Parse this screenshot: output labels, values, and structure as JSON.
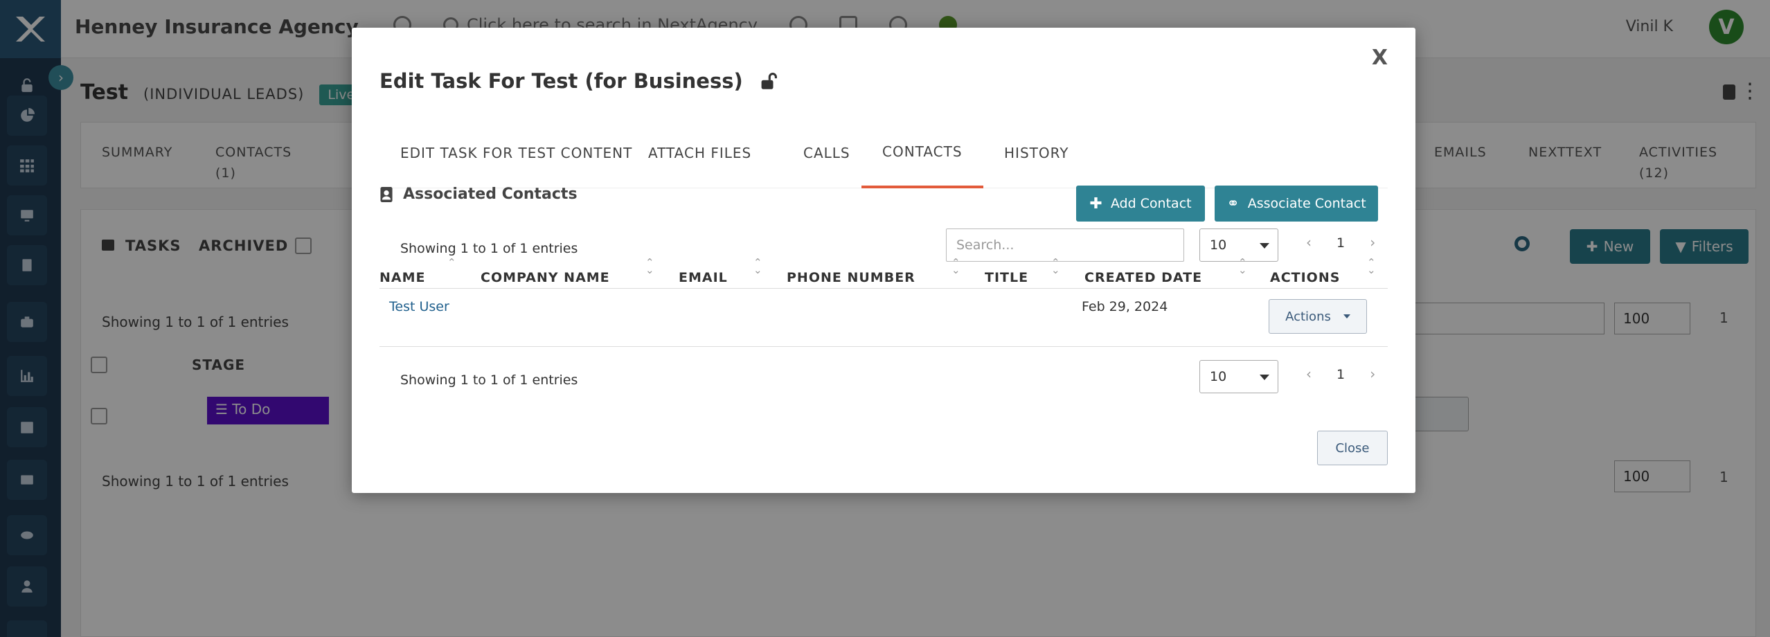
{
  "header": {
    "agency_name": "Henney Insurance Agency",
    "search_hint": "Click here to search in NextAgency",
    "user_name": "Vinil K",
    "avatar_initial": "V"
  },
  "record": {
    "title": "Test",
    "subtitle": "(INDIVIDUAL LEADS)",
    "status": "Live",
    "tabs": [
      {
        "label": "SUMMARY",
        "count": ""
      },
      {
        "label": "CONTACTS",
        "count": "(1)"
      },
      {
        "label": "EMAILS",
        "count": ""
      },
      {
        "label": "NEXTTEXT",
        "count": ""
      },
      {
        "label": "ACTIVITIES",
        "count": "(12)"
      }
    ]
  },
  "tasks_panel": {
    "title": "TASKS",
    "archived_label": "ARCHIVED",
    "showing_text": "Showing 1 to 1 of 1 entries",
    "stage_header": "STAGE",
    "stage_value": "To Do",
    "new_label": "New",
    "filters_label": "Filters",
    "page_size": "100",
    "page": "1"
  },
  "modal": {
    "title": "Edit Task For Test (for Business)",
    "close_x": "X",
    "tabs": [
      {
        "label": "EDIT TASK FOR TEST CONTENT",
        "active": false
      },
      {
        "label": "ATTACH FILES",
        "active": false
      },
      {
        "label": "CALLS",
        "active": false
      },
      {
        "label": "CONTACTS",
        "active": true
      },
      {
        "label": "HISTORY",
        "active": false
      }
    ],
    "section_title": "Associated Contacts",
    "add_contact_label": "Add Contact",
    "associate_contact_label": "Associate Contact",
    "showing_text_top": "Showing 1 to 1 of 1 entries",
    "showing_text_bottom": "Showing 1 to 1 of 1 entries",
    "search_placeholder": "Search...",
    "page_size": "10",
    "page": "1",
    "columns": [
      "NAME",
      "COMPANY NAME",
      "EMAIL",
      "PHONE NUMBER",
      "TITLE",
      "CREATED DATE",
      "ACTIONS"
    ],
    "rows": [
      {
        "name": "Test User",
        "company": "",
        "email": "",
        "phone": "",
        "title": "",
        "created": "Feb 29, 2024",
        "actions_label": "Actions"
      }
    ],
    "close_label": "Close"
  },
  "colors": {
    "accent_teal": "#2f8394",
    "active_tab_underline": "#e25b3b",
    "stage_todo": "#5b0fcc",
    "live_badge": "#3aa397",
    "avatar": "#2f8a2f"
  }
}
